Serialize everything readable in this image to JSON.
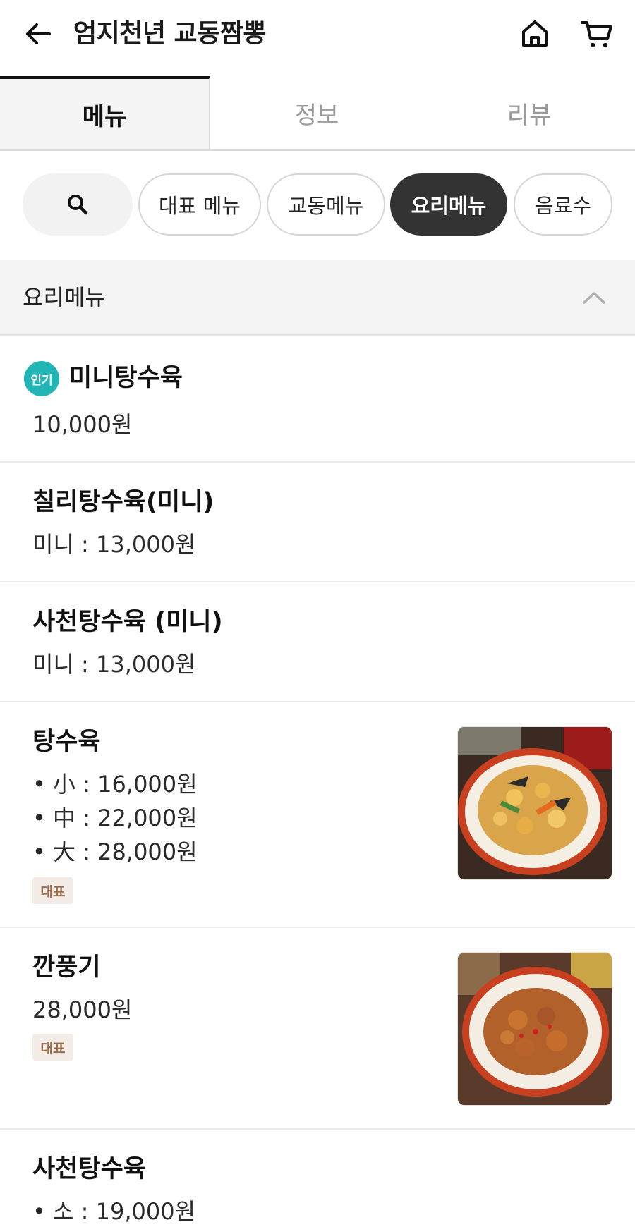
{
  "header": {
    "title": "엄지천년 교동짬뽕",
    "back_icon": "arrow-left-icon",
    "home_icon": "home-icon",
    "cart_icon": "cart-icon"
  },
  "tabs": [
    {
      "label": "메뉴",
      "active": true
    },
    {
      "label": "정보",
      "active": false
    },
    {
      "label": "리뷰",
      "active": false
    }
  ],
  "chips": {
    "search_icon": "search-icon",
    "items": [
      "대표 메뉴",
      "교동메뉴",
      "요리메뉴",
      "음료수"
    ],
    "selected": "요리메뉴"
  },
  "section": {
    "title": "요리메뉴",
    "collapse_icon": "chevron-up-icon"
  },
  "menu": [
    {
      "name": "미니탕수육",
      "badge": "인기",
      "price": "10,000원"
    },
    {
      "name": "칠리탕수육(미니)",
      "price": "미니 : 13,000원"
    },
    {
      "name": "사천탕수육 (미니)",
      "price": "미니 : 13,000원"
    },
    {
      "name": "탕수육",
      "prices": [
        "• 小 : 16,000원",
        "• 中 : 22,000원",
        "• 大 : 28,000원"
      ],
      "tag": "대표",
      "image": "sweet-and-sour-pork-photo"
    },
    {
      "name": "깐풍기",
      "price": "28,000원",
      "tag": "대표",
      "image": "kkanpunggi-photo"
    },
    {
      "name": "사천탕수육",
      "prices": [
        "• 소 : 19,000원"
      ]
    }
  ],
  "colors": {
    "accent_dark": "#333333",
    "popular_badge": "#22b5b5",
    "rep_tag_bg": "#f3ece6",
    "rep_tag_text": "#9a6a4a"
  }
}
